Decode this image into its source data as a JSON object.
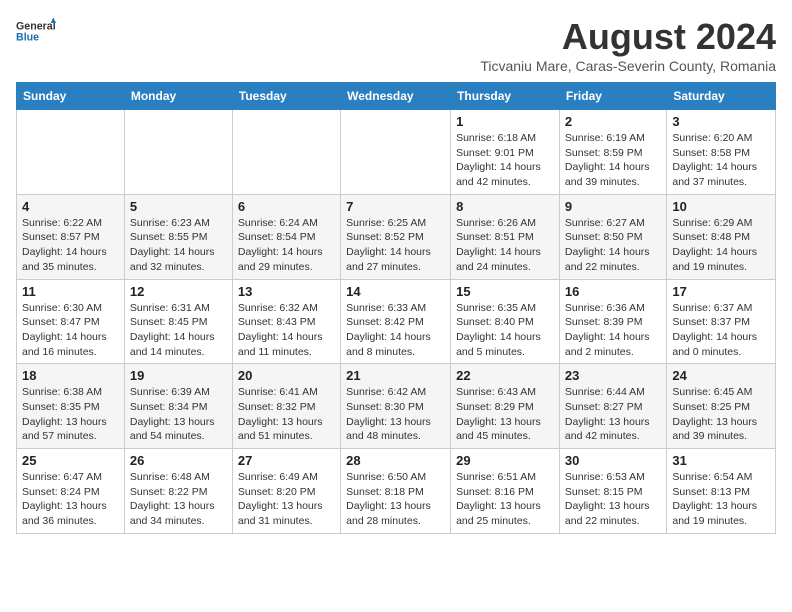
{
  "logo": {
    "general": "General",
    "blue": "Blue"
  },
  "title": "August 2024",
  "subtitle": "Ticvaniu Mare, Caras-Severin County, Romania",
  "headers": [
    "Sunday",
    "Monday",
    "Tuesday",
    "Wednesday",
    "Thursday",
    "Friday",
    "Saturday"
  ],
  "weeks": [
    [
      {
        "num": "",
        "detail": ""
      },
      {
        "num": "",
        "detail": ""
      },
      {
        "num": "",
        "detail": ""
      },
      {
        "num": "",
        "detail": ""
      },
      {
        "num": "1",
        "detail": "Sunrise: 6:18 AM\nSunset: 9:01 PM\nDaylight: 14 hours and 42 minutes."
      },
      {
        "num": "2",
        "detail": "Sunrise: 6:19 AM\nSunset: 8:59 PM\nDaylight: 14 hours and 39 minutes."
      },
      {
        "num": "3",
        "detail": "Sunrise: 6:20 AM\nSunset: 8:58 PM\nDaylight: 14 hours and 37 minutes."
      }
    ],
    [
      {
        "num": "4",
        "detail": "Sunrise: 6:22 AM\nSunset: 8:57 PM\nDaylight: 14 hours and 35 minutes."
      },
      {
        "num": "5",
        "detail": "Sunrise: 6:23 AM\nSunset: 8:55 PM\nDaylight: 14 hours and 32 minutes."
      },
      {
        "num": "6",
        "detail": "Sunrise: 6:24 AM\nSunset: 8:54 PM\nDaylight: 14 hours and 29 minutes."
      },
      {
        "num": "7",
        "detail": "Sunrise: 6:25 AM\nSunset: 8:52 PM\nDaylight: 14 hours and 27 minutes."
      },
      {
        "num": "8",
        "detail": "Sunrise: 6:26 AM\nSunset: 8:51 PM\nDaylight: 14 hours and 24 minutes."
      },
      {
        "num": "9",
        "detail": "Sunrise: 6:27 AM\nSunset: 8:50 PM\nDaylight: 14 hours and 22 minutes."
      },
      {
        "num": "10",
        "detail": "Sunrise: 6:29 AM\nSunset: 8:48 PM\nDaylight: 14 hours and 19 minutes."
      }
    ],
    [
      {
        "num": "11",
        "detail": "Sunrise: 6:30 AM\nSunset: 8:47 PM\nDaylight: 14 hours and 16 minutes."
      },
      {
        "num": "12",
        "detail": "Sunrise: 6:31 AM\nSunset: 8:45 PM\nDaylight: 14 hours and 14 minutes."
      },
      {
        "num": "13",
        "detail": "Sunrise: 6:32 AM\nSunset: 8:43 PM\nDaylight: 14 hours and 11 minutes."
      },
      {
        "num": "14",
        "detail": "Sunrise: 6:33 AM\nSunset: 8:42 PM\nDaylight: 14 hours and 8 minutes."
      },
      {
        "num": "15",
        "detail": "Sunrise: 6:35 AM\nSunset: 8:40 PM\nDaylight: 14 hours and 5 minutes."
      },
      {
        "num": "16",
        "detail": "Sunrise: 6:36 AM\nSunset: 8:39 PM\nDaylight: 14 hours and 2 minutes."
      },
      {
        "num": "17",
        "detail": "Sunrise: 6:37 AM\nSunset: 8:37 PM\nDaylight: 14 hours and 0 minutes."
      }
    ],
    [
      {
        "num": "18",
        "detail": "Sunrise: 6:38 AM\nSunset: 8:35 PM\nDaylight: 13 hours and 57 minutes."
      },
      {
        "num": "19",
        "detail": "Sunrise: 6:39 AM\nSunset: 8:34 PM\nDaylight: 13 hours and 54 minutes."
      },
      {
        "num": "20",
        "detail": "Sunrise: 6:41 AM\nSunset: 8:32 PM\nDaylight: 13 hours and 51 minutes."
      },
      {
        "num": "21",
        "detail": "Sunrise: 6:42 AM\nSunset: 8:30 PM\nDaylight: 13 hours and 48 minutes."
      },
      {
        "num": "22",
        "detail": "Sunrise: 6:43 AM\nSunset: 8:29 PM\nDaylight: 13 hours and 45 minutes."
      },
      {
        "num": "23",
        "detail": "Sunrise: 6:44 AM\nSunset: 8:27 PM\nDaylight: 13 hours and 42 minutes."
      },
      {
        "num": "24",
        "detail": "Sunrise: 6:45 AM\nSunset: 8:25 PM\nDaylight: 13 hours and 39 minutes."
      }
    ],
    [
      {
        "num": "25",
        "detail": "Sunrise: 6:47 AM\nSunset: 8:24 PM\nDaylight: 13 hours and 36 minutes."
      },
      {
        "num": "26",
        "detail": "Sunrise: 6:48 AM\nSunset: 8:22 PM\nDaylight: 13 hours and 34 minutes."
      },
      {
        "num": "27",
        "detail": "Sunrise: 6:49 AM\nSunset: 8:20 PM\nDaylight: 13 hours and 31 minutes."
      },
      {
        "num": "28",
        "detail": "Sunrise: 6:50 AM\nSunset: 8:18 PM\nDaylight: 13 hours and 28 minutes."
      },
      {
        "num": "29",
        "detail": "Sunrise: 6:51 AM\nSunset: 8:16 PM\nDaylight: 13 hours and 25 minutes."
      },
      {
        "num": "30",
        "detail": "Sunrise: 6:53 AM\nSunset: 8:15 PM\nDaylight: 13 hours and 22 minutes."
      },
      {
        "num": "31",
        "detail": "Sunrise: 6:54 AM\nSunset: 8:13 PM\nDaylight: 13 hours and 19 minutes."
      }
    ]
  ]
}
